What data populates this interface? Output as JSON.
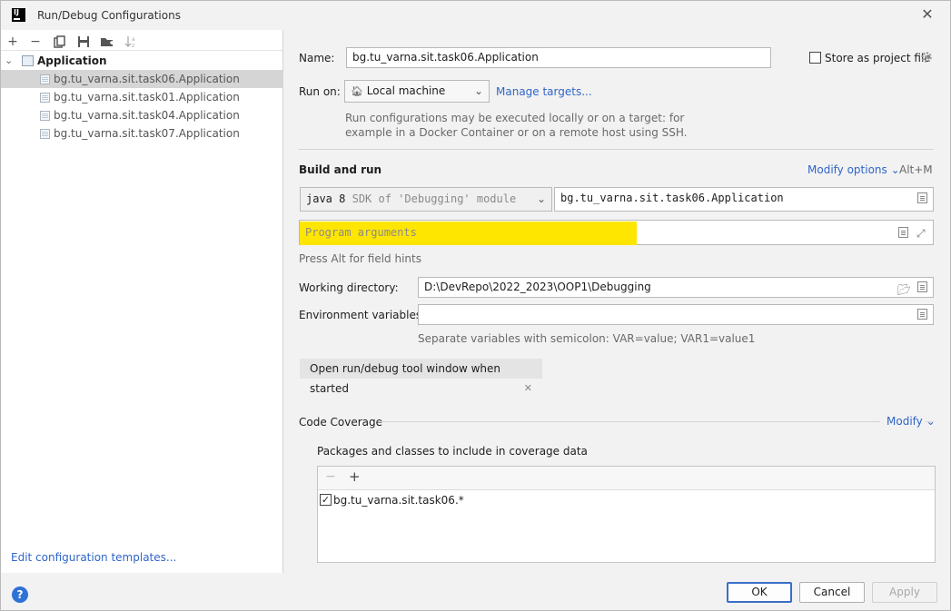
{
  "window": {
    "title": "Run/Debug Configurations",
    "logo_text": "IJ"
  },
  "toolbar": {
    "add": "+",
    "remove": "−",
    "copy": "⧉",
    "save": "💾",
    "move_to_folder": "📁",
    "sort": "↓"
  },
  "tree": {
    "root_label": "Application",
    "items": [
      {
        "label": "bg.tu_varna.sit.task06.Application",
        "selected": true
      },
      {
        "label": "bg.tu_varna.sit.task01.Application",
        "selected": false
      },
      {
        "label": "bg.tu_varna.sit.task04.Application",
        "selected": false
      },
      {
        "label": "bg.tu_varna.sit.task07.Application",
        "selected": false
      }
    ]
  },
  "left_footer": {
    "edit_templates": "Edit configuration templates..."
  },
  "config": {
    "name_label": "Name:",
    "name_value": "bg.tu_varna.sit.task06.Application",
    "store_label": "Store as project file",
    "store_checked": false,
    "run_on_label": "Run on:",
    "run_on_value": "Local machine",
    "manage_targets": "Manage targets...",
    "run_on_hint_1": "Run configurations may be executed locally or on a target: for",
    "run_on_hint_2": "example in a Docker Container or on a remote host using SSH."
  },
  "build_and_run": {
    "title": "Build and run",
    "modify_options": "Modify options",
    "shortcut": "Alt+M",
    "jdk_bold": "java 8",
    "jdk_detail": "SDK of 'Debugging' module",
    "main_class": "bg.tu_varna.sit.task06.Application",
    "program_args_placeholder": "Program arguments",
    "press_alt_hint": "Press Alt for field hints",
    "working_dir_label": "Working directory:",
    "working_dir_value": "D:\\DevRepo\\2022_2023\\OOP1\\Debugging",
    "env_vars_label": "Environment variables:",
    "env_vars_value": "",
    "env_vars_hint": "Separate variables with semicolon: VAR=value; VAR1=value1",
    "open_tool_window_tag": "Open run/debug tool window when started"
  },
  "code_coverage": {
    "title": "Code Coverage",
    "modify": "Modify",
    "packages_label": "Packages and classes to include in coverage data",
    "entries": [
      {
        "label": "bg.tu_varna.sit.task06.*",
        "checked": true
      }
    ]
  },
  "buttons": {
    "ok": "OK",
    "cancel": "Cancel",
    "apply": "Apply",
    "help": "?"
  },
  "colors": {
    "highlight": "#ffe600",
    "link": "#2f65ca",
    "selection": "#d5d5d5"
  }
}
